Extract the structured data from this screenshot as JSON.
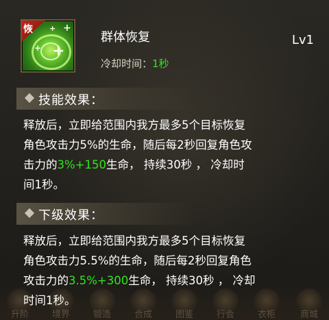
{
  "skill": {
    "icon_name": "heal-aura-icon",
    "icon_badge": "恢",
    "name": "群体恢复",
    "level": "Lv1",
    "cooldown_label": "冷却时间：",
    "cooldown_value": "1秒"
  },
  "sections": [
    {
      "title": "技能效果：",
      "lines": [
        [
          "释放后，立即给范围内我方最多5个目标恢复"
        ],
        [
          "角色攻击力5%的生命，随后每2秒回复角色攻"
        ],
        [
          "击力的",
          "3%+150",
          "生命， 持续30秒 ， 冷却时"
        ],
        [
          "间1秒。"
        ]
      ]
    },
    {
      "title": "下级效果：",
      "lines": [
        [
          "释放后，立即给范围内我方最多5个目标恢复"
        ],
        [
          "角色攻击力5.5%的生命，随后每2秒回复角色"
        ],
        [
          "攻击力的",
          "3.5%+300",
          "生命， 持续30秒 ， 冷却"
        ],
        [
          "时间1秒。"
        ]
      ]
    }
  ],
  "bottom_bar": [
    "升阶",
    "境界",
    "锻造",
    "合成",
    "图鉴",
    "行会",
    "衣柜",
    "商城"
  ],
  "colors": {
    "highlight_green": "#2fe61f",
    "text_white": "#ffffff",
    "panel_bg": "#24221e"
  }
}
